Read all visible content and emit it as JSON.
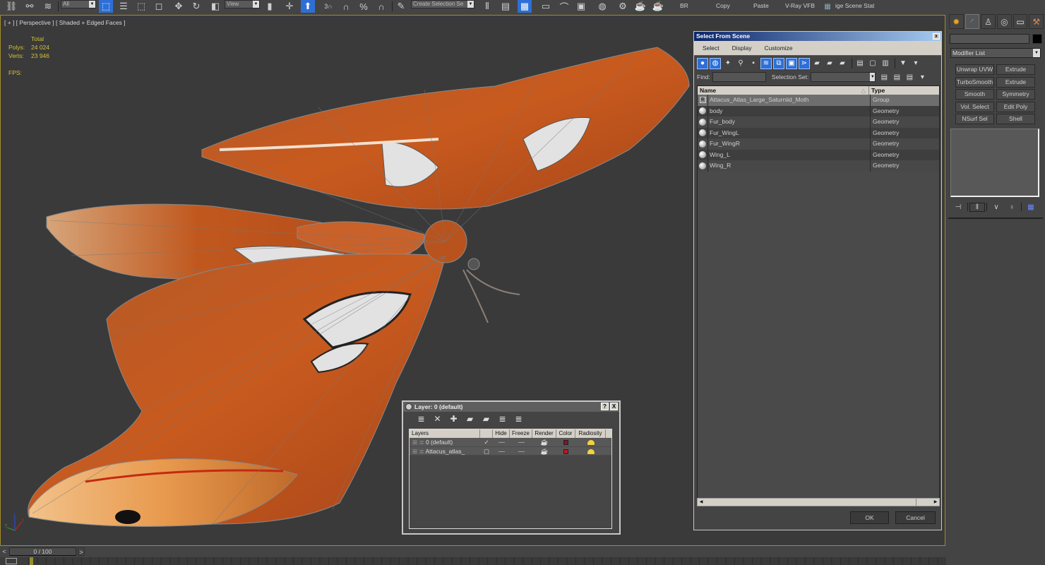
{
  "toolbar": {
    "selection_filter": "All",
    "reference_coord": "View",
    "named_selection_placeholder": "Create Selection Se",
    "labels": [
      "BR",
      "Copy",
      "Paste",
      "V-Ray VFB",
      "ige Scene Stat"
    ],
    "snap_angle_label": "3"
  },
  "viewport": {
    "label": "[ + ] [ Perspective ] [ Shaded + Edged Faces ]",
    "stats": {
      "header": "Total",
      "polys_label": "Polys:",
      "polys": "24 024",
      "verts_label": "Verts:",
      "verts": "23 946",
      "fps_label": "FPS:"
    },
    "axis": {
      "x": "x",
      "y": "y",
      "z": "z"
    }
  },
  "select_from_scene": {
    "title": "Select From Scene",
    "close": "x",
    "menu": [
      "Select",
      "Display",
      "Customize"
    ],
    "find_label": "Find:",
    "find_value": "",
    "selection_set_label": "Selection Set:",
    "selection_set_value": "",
    "columns": {
      "name": "Name",
      "type": "Type"
    },
    "rows": [
      {
        "name": "Attacus_Atlas_Large_Saturniid_Moth",
        "type": "Group",
        "icon": "group-icon",
        "selected": true
      },
      {
        "name": "body",
        "type": "Geometry",
        "icon": "geometry-sphere-icon"
      },
      {
        "name": "Fur_body",
        "type": "Geometry",
        "icon": "geometry-sphere-icon"
      },
      {
        "name": "Fur_WingL",
        "type": "Geometry",
        "icon": "geometry-sphere-icon"
      },
      {
        "name": "Fur_WingR",
        "type": "Geometry",
        "icon": "geometry-sphere-icon"
      },
      {
        "name": "Wing_L",
        "type": "Geometry",
        "icon": "geometry-sphere-icon"
      },
      {
        "name": "Wing_R",
        "type": "Geometry",
        "icon": "geometry-sphere-icon"
      }
    ],
    "ok": "OK",
    "cancel": "Cancel"
  },
  "layer_dialog": {
    "title": "Layer: 0 (default)",
    "help": "?",
    "close": "X",
    "columns": [
      "Layers",
      "",
      "Hide",
      "Freeze",
      "Render",
      "Color",
      "Radiosity"
    ],
    "rows": [
      {
        "name": "0 (default)",
        "current": "✓",
        "color": "#8a0f2e"
      },
      {
        "name": "Attacus_atlas_",
        "current": "▢",
        "color": "#c0141c"
      }
    ]
  },
  "command_panel": {
    "tabs": [
      "create-icon",
      "modify-icon",
      "hierarchy-icon",
      "motion-icon",
      "display-icon",
      "utilities-icon"
    ],
    "modifier_list": "Modifier List",
    "modifier_buttons": [
      [
        "Unwrap UVW",
        "Extrude"
      ],
      [
        "TurboSmooth",
        "Extrude"
      ],
      [
        "Smooth",
        "Symmetry"
      ],
      [
        "Vol. Select",
        "Edit Poly"
      ],
      [
        "NSurf Sel",
        "Shell"
      ]
    ]
  },
  "time_slider": {
    "prev": "<",
    "frame": "0 / 100",
    "next": ">",
    "current_frame": 0,
    "total_frames": 100
  }
}
